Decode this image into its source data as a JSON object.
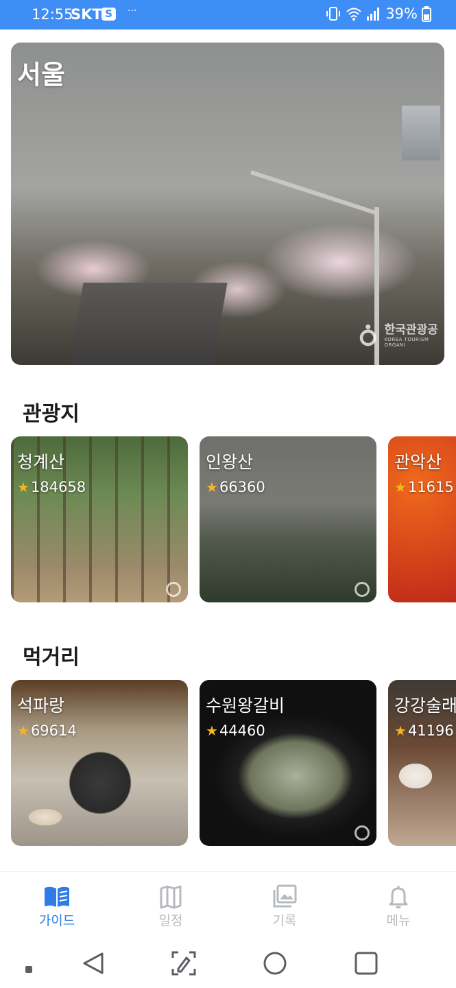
{
  "status_bar": {
    "time": "12:55",
    "carrier": "SKT",
    "carrier_badge": "S",
    "more": "···",
    "battery": "39%",
    "bg_color": "#3f8ef5"
  },
  "hero": {
    "title": "서울",
    "watermark": "한국관광공",
    "watermark_sub": "KOREA TOURISM ORGANI"
  },
  "sections": {
    "tourist": {
      "title": "관광지",
      "cards": [
        {
          "name": "청계산",
          "rating": "184658"
        },
        {
          "name": "인왕산",
          "rating": "66360"
        },
        {
          "name": "관악산",
          "rating": "11615"
        }
      ]
    },
    "food": {
      "title": "먹거리",
      "cards": [
        {
          "name": "석파랑",
          "rating": "69614"
        },
        {
          "name": "수원왕갈비",
          "rating": "44460"
        },
        {
          "name": "강강술래",
          "rating": "41196"
        }
      ]
    }
  },
  "bottom_nav": {
    "items": [
      {
        "label": "가이드",
        "icon": "book-icon",
        "active": true
      },
      {
        "label": "일정",
        "icon": "map-icon",
        "active": false
      },
      {
        "label": "기록",
        "icon": "gallery-icon",
        "active": false
      },
      {
        "label": "메뉴",
        "icon": "bell-icon",
        "active": false
      }
    ],
    "active_color": "#2f7ce8",
    "inactive_color": "#b6b9be"
  },
  "system_nav": {
    "icons": [
      "recents-dot-icon",
      "back-icon",
      "edit-screen-icon",
      "home-icon",
      "overview-icon"
    ]
  }
}
